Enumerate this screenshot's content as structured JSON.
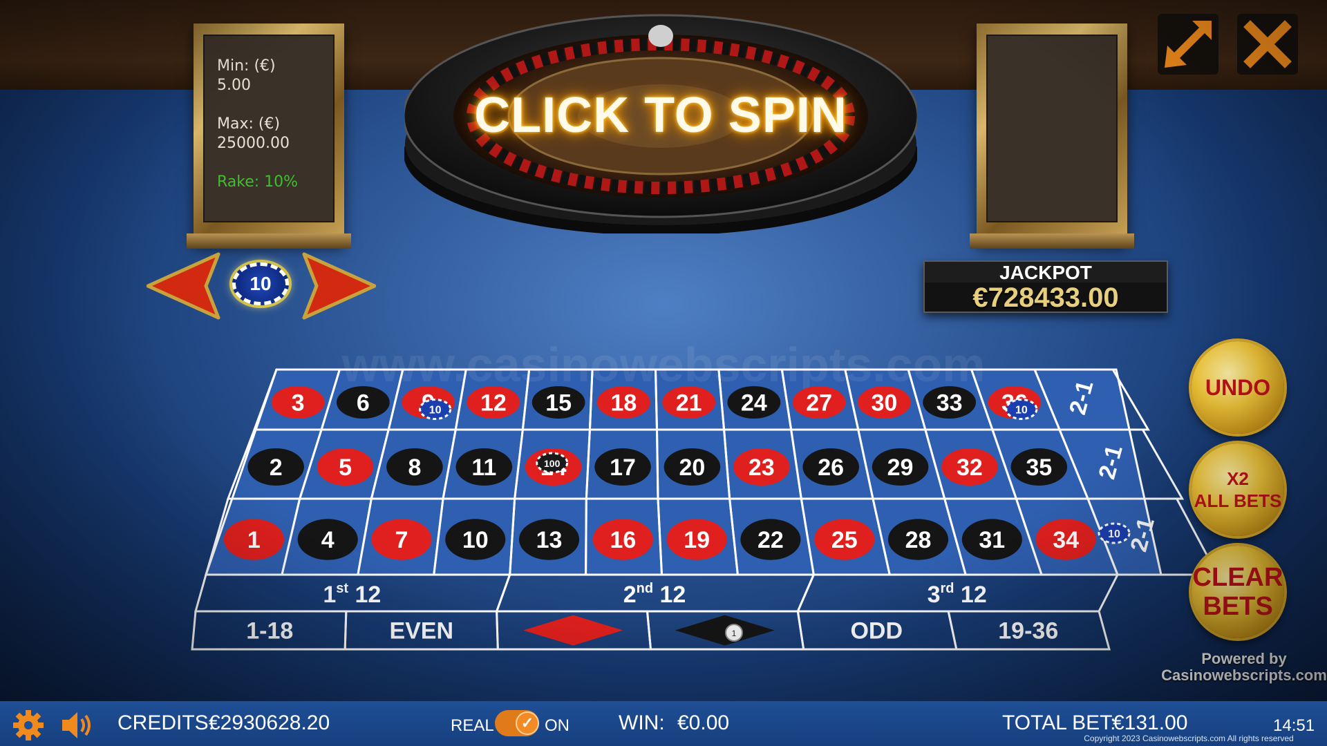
{
  "limits": {
    "min_label": "Min: (€)",
    "min_value": "5.00",
    "max_label": "Max: (€)",
    "max_value": "25000.00",
    "rake_label": "Rake:",
    "rake_value": "10%"
  },
  "wheel": {
    "cta": "CLICK TO SPIN"
  },
  "controls": {
    "expand_icon": "expand-icon",
    "close_icon": "close-icon"
  },
  "chip_selector": {
    "value": "10",
    "prev_icon": "arrow-left-icon",
    "next_icon": "arrow-right-icon"
  },
  "jackpot": {
    "title": "JACKPOT",
    "amount": "€728433.00"
  },
  "table": {
    "top_row": [
      "3",
      "6",
      "9",
      "12",
      "15",
      "18",
      "21",
      "24",
      "27",
      "30",
      "33",
      "36"
    ],
    "mid_row": [
      "2",
      "5",
      "8",
      "11",
      "14",
      "17",
      "20",
      "23",
      "26",
      "29",
      "32",
      "35"
    ],
    "bot_row": [
      "1",
      "4",
      "7",
      "10",
      "13",
      "16",
      "19",
      "22",
      "25",
      "28",
      "31",
      "34"
    ],
    "red_numbers": [
      "1",
      "3",
      "5",
      "7",
      "9",
      "12",
      "14",
      "16",
      "18",
      "19",
      "21",
      "23",
      "25",
      "27",
      "30",
      "32",
      "34",
      "36"
    ],
    "column_bets": [
      "2-1",
      "2-1",
      "2-1"
    ],
    "dozens": [
      {
        "num": "1",
        "sup": "st",
        "word": "12"
      },
      {
        "num": "2",
        "sup": "nd",
        "word": "12"
      },
      {
        "num": "3",
        "sup": "rd",
        "word": "12"
      }
    ],
    "outside": [
      "1-18",
      "EVEN",
      "",
      "",
      "ODD",
      "19-36"
    ],
    "placed_chips": [
      {
        "bet": "9",
        "value": "10"
      },
      {
        "bet": "36",
        "value": "10"
      },
      {
        "bet": "14",
        "value": "100"
      },
      {
        "bet": "2-1 bottom",
        "value": "10"
      },
      {
        "bet": "black",
        "value": "1"
      }
    ],
    "watermark": "www.casinowebscripts.com"
  },
  "side_buttons": {
    "undo": "UNDO",
    "x2_line1": "X2",
    "x2_line2": "ALL BETS",
    "clear_line1": "CLEAR",
    "clear_line2": "BETS"
  },
  "powered": {
    "line1": "Powered by",
    "line2": "Casinowebscripts.com"
  },
  "bottom_bar": {
    "settings_icon": "gear-icon",
    "sound_icon": "speaker-icon",
    "credits_label": "CREDITS:",
    "credits_value": "€2930628.20",
    "real_label": "REAL",
    "toggle_state": "ON",
    "win_label": "WIN:",
    "win_value": "€0.00",
    "total_bet_label": "TOTAL BET:",
    "total_bet_value": "€131.00",
    "clock": "14:51",
    "copyright": "Copyright 2023 Casinowebscripts.com All rights reserved"
  },
  "colors": {
    "red": "#e0201e",
    "black": "#151515",
    "felt": "#2e5898",
    "gold": "#e8cf7e",
    "button_text": "#c0121a"
  }
}
